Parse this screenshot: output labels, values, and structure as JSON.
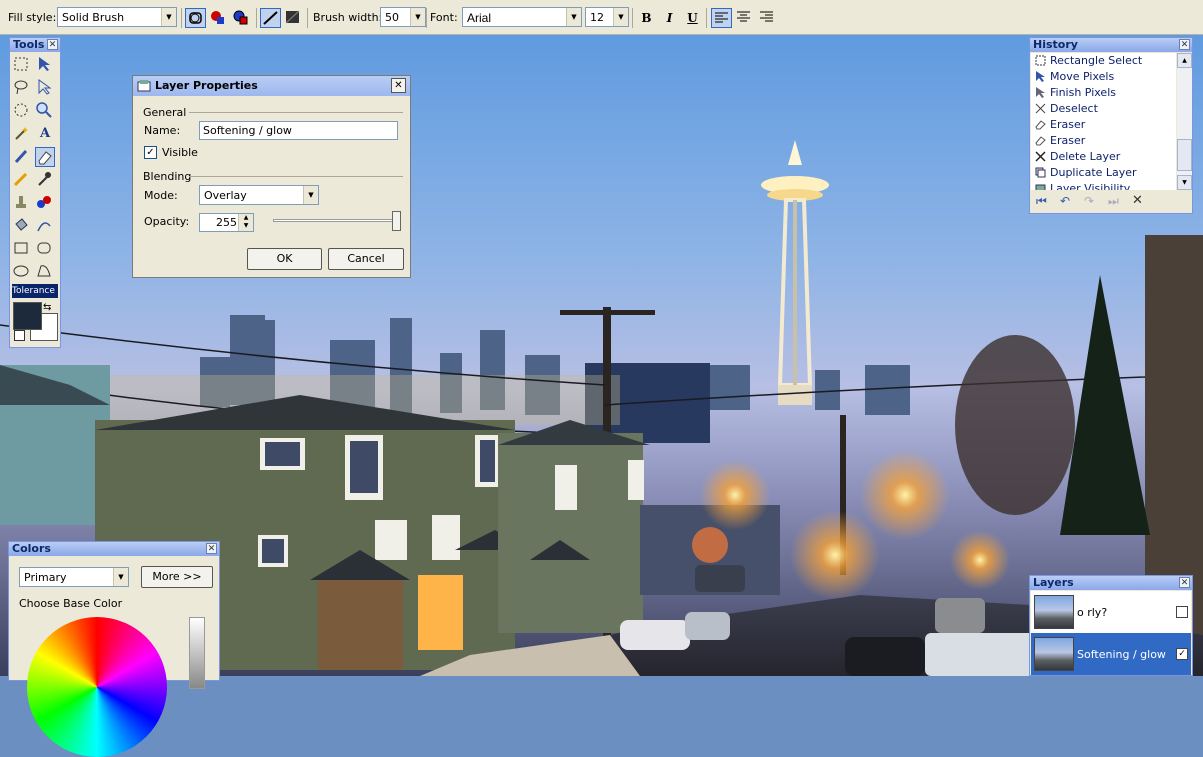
{
  "toolbar": {
    "fill_style_label": "Fill style:",
    "fill_style_value": "Solid Brush",
    "brush_width_label": "Brush width:",
    "brush_width_value": "50",
    "font_label": "Font:",
    "font_value": "Arial",
    "font_size_value": "12",
    "bold_label": "B",
    "italic_label": "I",
    "underline_label": "U"
  },
  "tools": {
    "title": "Tools",
    "tolerance_label": "Tolerance"
  },
  "layer_properties": {
    "title": "Layer Properties",
    "general_label": "General",
    "name_label": "Name:",
    "name_value": "Softening / glow",
    "visible_label": "Visible",
    "visible_checked": true,
    "blending_label": "Blending",
    "mode_label": "Mode:",
    "mode_value": "Overlay",
    "opacity_label": "Opacity:",
    "opacity_value": "255",
    "opacity_slider_fraction": 1.0,
    "ok_label": "OK",
    "cancel_label": "Cancel"
  },
  "history": {
    "title": "History",
    "items": [
      {
        "label": "Rectangle Select",
        "icon": "rectangle-select-icon"
      },
      {
        "label": "Move Pixels",
        "icon": "move-pixels-icon"
      },
      {
        "label": "Finish Pixels",
        "icon": "finish-pixels-icon"
      },
      {
        "label": "Deselect",
        "icon": "deselect-icon"
      },
      {
        "label": "Eraser",
        "icon": "eraser-icon"
      },
      {
        "label": "Eraser",
        "icon": "eraser-icon"
      },
      {
        "label": "Delete Layer",
        "icon": "delete-layer-icon"
      },
      {
        "label": "Duplicate Layer",
        "icon": "duplicate-layer-icon"
      },
      {
        "label": "Layer Visibility",
        "icon": "layer-visibility-icon"
      }
    ]
  },
  "colors": {
    "title": "Colors",
    "palette_value": "Primary",
    "more_label": "More >>",
    "choose_base_label": "Choose Base Color"
  },
  "layers": {
    "title": "Layers",
    "items": [
      {
        "name": "o rly?",
        "visible": false,
        "selected": false
      },
      {
        "name": "Softening / glow",
        "visible": true,
        "selected": true
      }
    ]
  },
  "theme": {
    "titlebar_color": "#9db7ee",
    "selection_color": "#316ac5",
    "panel_bg": "#ece9d8"
  }
}
